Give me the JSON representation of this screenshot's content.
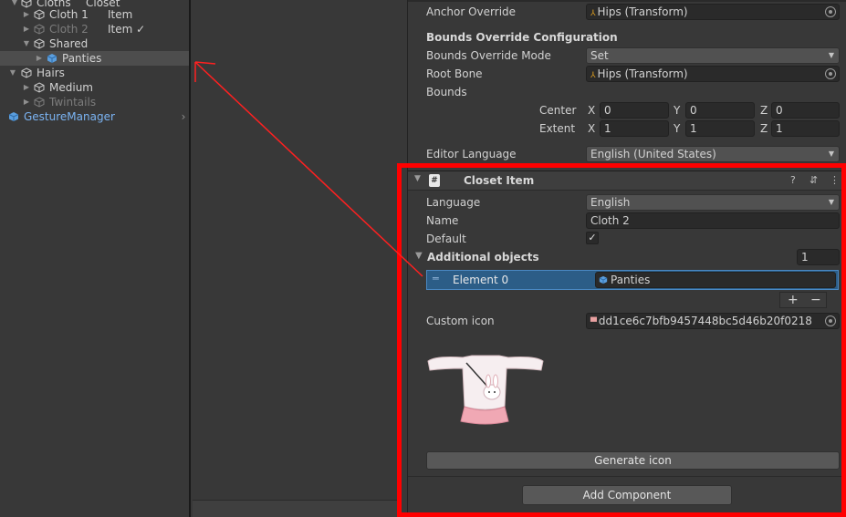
{
  "hierarchy": {
    "items": [
      {
        "label": "Cloths",
        "tag": "Closet"
      },
      {
        "label": "Cloth 1",
        "tag": "Item"
      },
      {
        "label": "Cloth 2",
        "tag": "Item ✓"
      },
      {
        "label": "Shared"
      },
      {
        "label": "Panties"
      },
      {
        "label": "Hairs"
      },
      {
        "label": "Medium"
      },
      {
        "label": "Twintails"
      },
      {
        "label": "GestureManager"
      }
    ]
  },
  "inspector": {
    "anchor_override": {
      "label": "Anchor Override",
      "value": "Hips (Transform)"
    },
    "bounds_section_title": "Bounds Override Configuration",
    "bounds_override_mode": {
      "label": "Bounds Override Mode",
      "value": "Set"
    },
    "root_bone": {
      "label": "Root Bone",
      "value": "Hips (Transform)"
    },
    "bounds": {
      "label": "Bounds",
      "center": {
        "label": "Center",
        "x": "0",
        "y": "0",
        "z": "0"
      },
      "extent": {
        "label": "Extent",
        "x": "1",
        "y": "1",
        "z": "1"
      }
    },
    "axes": {
      "x": "X",
      "y": "Y",
      "z": "Z"
    },
    "editor_language": {
      "label": "Editor Language",
      "value": "English (United States)"
    },
    "component": {
      "title": "Closet Item",
      "header_icon_glyph": "#",
      "language": {
        "label": "Language",
        "value": "English"
      },
      "name": {
        "label": "Name",
        "value": "Cloth 2"
      },
      "default": {
        "label": "Default",
        "checked": "✓"
      },
      "additional_objects": {
        "label": "Additional objects",
        "count": "1"
      },
      "element0": {
        "label": "Element 0",
        "value": "Panties"
      },
      "plus": "+",
      "minus": "−",
      "custom_icon": {
        "label": "Custom icon",
        "value": "dd1ce6c7bfb9457448bc5d46b20f0218"
      },
      "generate_icon_label": "Generate icon"
    },
    "add_component_label": "Add Component"
  },
  "icons": [
    "cube-icon",
    "prefab-cube-icon",
    "script-icon",
    "help-icon",
    "settings-icon",
    "more-icon",
    "object-picker-icon",
    "transform-icon",
    "texture-icon",
    "drag-handle-icon"
  ],
  "colors": {
    "annotation": "#ff0000",
    "selection": "#2c5d87",
    "prefab_blue": "#7bb4f3"
  }
}
